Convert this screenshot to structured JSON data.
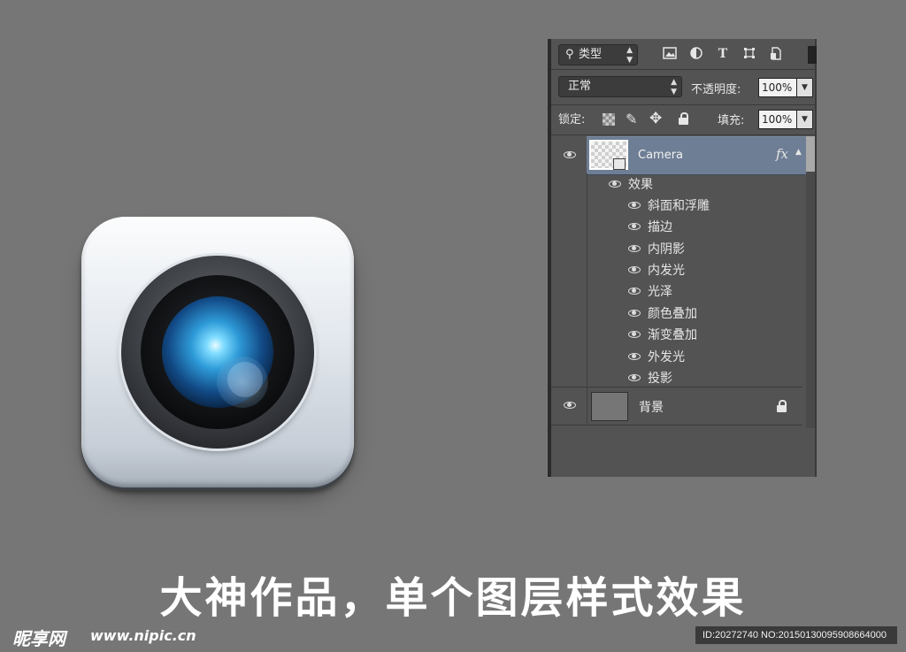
{
  "layers_panel": {
    "filter_kind": "类型",
    "blend_mode": "正常",
    "opacity_label": "不透明度:",
    "opacity_value": "100%",
    "lock_label": "锁定:",
    "fill_label": "填充:",
    "fill_value": "100%",
    "toolbar_icons": [
      "image-filter-icon",
      "adjustment-filter-icon",
      "type-filter-icon",
      "shape-filter-icon",
      "smart-object-filter-icon"
    ],
    "layers": [
      {
        "name": "Camera",
        "selected": true,
        "fx": "fx",
        "effects_label": "效果",
        "effects": [
          "斜面和浮雕",
          "描边",
          "内阴影",
          "内发光",
          "光泽",
          "颜色叠加",
          "渐变叠加",
          "外发光",
          "投影"
        ]
      },
      {
        "name": "背景",
        "locked": true
      }
    ]
  },
  "caption": "大神作品，单个图层样式效果",
  "watermark": {
    "logo_text": "昵享网",
    "url": "www.nipic.cn",
    "id_text": "ID:20272740 NO:20150130095908664000"
  },
  "colors": {
    "background": "#767676",
    "panel": "#535353",
    "selected_layer": "#6e7e94"
  }
}
